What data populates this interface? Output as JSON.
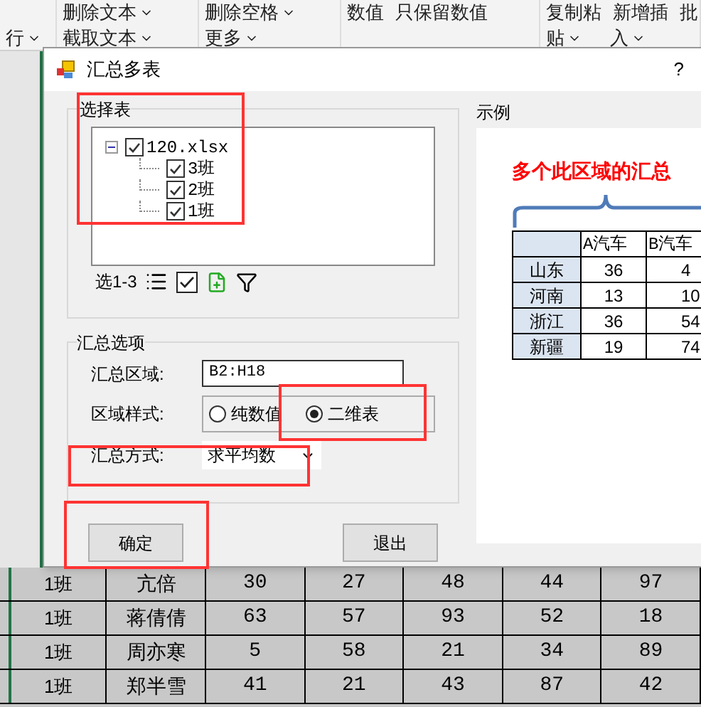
{
  "ribbon": {
    "groups": [
      {
        "bottom": [
          {
            "label": "行",
            "dropdown": true
          }
        ]
      },
      {
        "top": [
          {
            "label": "删除文本",
            "dropdown": true
          }
        ],
        "bottom": [
          {
            "label": "截取文本",
            "dropdown": true
          }
        ]
      },
      {
        "top": [
          {
            "label": "删除空格",
            "dropdown": true
          }
        ],
        "bottom": [
          {
            "label": "更多",
            "dropdown": true
          }
        ]
      },
      {
        "top": [
          {
            "label": "数值",
            "dropdown": false
          },
          {
            "label": "只保留数值",
            "dropdown": false
          }
        ]
      },
      {
        "top": [
          {
            "label": "复制粘",
            "dropdown": false
          },
          {
            "label": "新增插",
            "dropdown": false
          },
          {
            "label": "批",
            "dropdown": false
          }
        ],
        "bottom": [
          {
            "label": "贴",
            "dropdown": true
          },
          {
            "label": "入",
            "dropdown": true
          }
        ]
      }
    ]
  },
  "dialog": {
    "title": "汇总多表",
    "help": "?",
    "sheet_group": {
      "title": "选择表",
      "tree": [
        {
          "label": "120.xlsx",
          "checked": true,
          "expanded": true,
          "children": [
            {
              "label": "3班",
              "checked": true
            },
            {
              "label": "2班",
              "checked": true
            },
            {
              "label": "1班",
              "checked": true
            }
          ]
        }
      ],
      "selection": "选1-3"
    },
    "example": {
      "title": "示例",
      "caption": "多个此区域的汇总",
      "columns": [
        "A汽车",
        "B汽车"
      ],
      "rows": [
        {
          "region": "山东",
          "values": [
            "36",
            "4"
          ]
        },
        {
          "region": "河南",
          "values": [
            "13",
            "10"
          ]
        },
        {
          "region": "浙江",
          "values": [
            "36",
            "54"
          ]
        },
        {
          "region": "新疆",
          "values": [
            "19",
            "74"
          ]
        }
      ]
    },
    "options": {
      "title": "汇总选项",
      "range_label": "汇总区域:",
      "range_value": "B2:H18",
      "style_label": "区域样式:",
      "style_options": [
        {
          "label": "纯数值",
          "selected": false
        },
        {
          "label": "二维表",
          "selected": true
        }
      ],
      "method_label": "汇总方式:",
      "method_value": "求平均数"
    },
    "buttons": [
      "确定",
      "退出"
    ]
  },
  "sheet": {
    "rows": [
      {
        "class": "1班",
        "name": "亢倍",
        "scores": [
          "30",
          "27",
          "48",
          "44",
          "97"
        ]
      },
      {
        "class": "1班",
        "name": "蒋倩倩",
        "scores": [
          "63",
          "57",
          "93",
          "52",
          "18"
        ]
      },
      {
        "class": "1班",
        "name": "周亦寒",
        "scores": [
          "5",
          "58",
          "21",
          "34",
          "89"
        ]
      },
      {
        "class": "1班",
        "name": "郑半雪",
        "scores": [
          "41",
          "21",
          "43",
          "87",
          "42"
        ]
      }
    ]
  }
}
